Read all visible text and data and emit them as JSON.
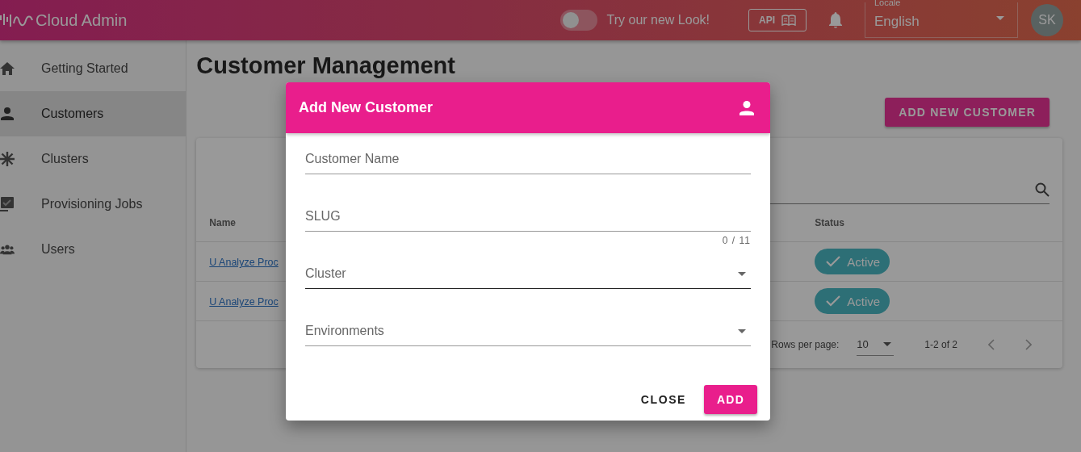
{
  "header": {
    "logo": "Cloud Admin",
    "toggle": {
      "label": "Try our new Look!",
      "on": false
    },
    "api_button": "API",
    "locale": {
      "label": "Locale",
      "value": "English"
    },
    "avatar": "SK"
  },
  "sidebar": {
    "items": [
      {
        "label": "Getting Started",
        "selected": false
      },
      {
        "label": "Customers",
        "selected": true
      },
      {
        "label": "Clusters",
        "selected": false
      },
      {
        "label": "Provisioning Jobs",
        "selected": false
      },
      {
        "label": "Users",
        "selected": false
      }
    ]
  },
  "page": {
    "title": "Customer Management",
    "add_button": "ADD NEW CUSTOMER"
  },
  "table": {
    "columns": [
      "Name",
      "Status"
    ],
    "rows": [
      {
        "name": "U Analyze Proc",
        "status": "Active"
      },
      {
        "name": "U Analyze Proc",
        "status": "Active"
      }
    ],
    "footer": {
      "rows_per_page_label": "Rows per page:",
      "rows_per_page": "10",
      "range": "1-2 of 2"
    }
  },
  "dialog": {
    "title": "Add New Customer",
    "fields": [
      {
        "kind": "text",
        "label": "Customer Name",
        "focused": false
      },
      {
        "kind": "text",
        "label": "SLUG",
        "counter": "0 / 11",
        "focused": false
      },
      {
        "kind": "select",
        "label": "Cluster",
        "focused": true
      },
      {
        "kind": "select",
        "label": "Environments",
        "focused": false
      }
    ],
    "buttons": [
      {
        "kind": "text",
        "label": "CLOSE"
      },
      {
        "kind": "primary",
        "label": "ADD"
      }
    ]
  }
}
